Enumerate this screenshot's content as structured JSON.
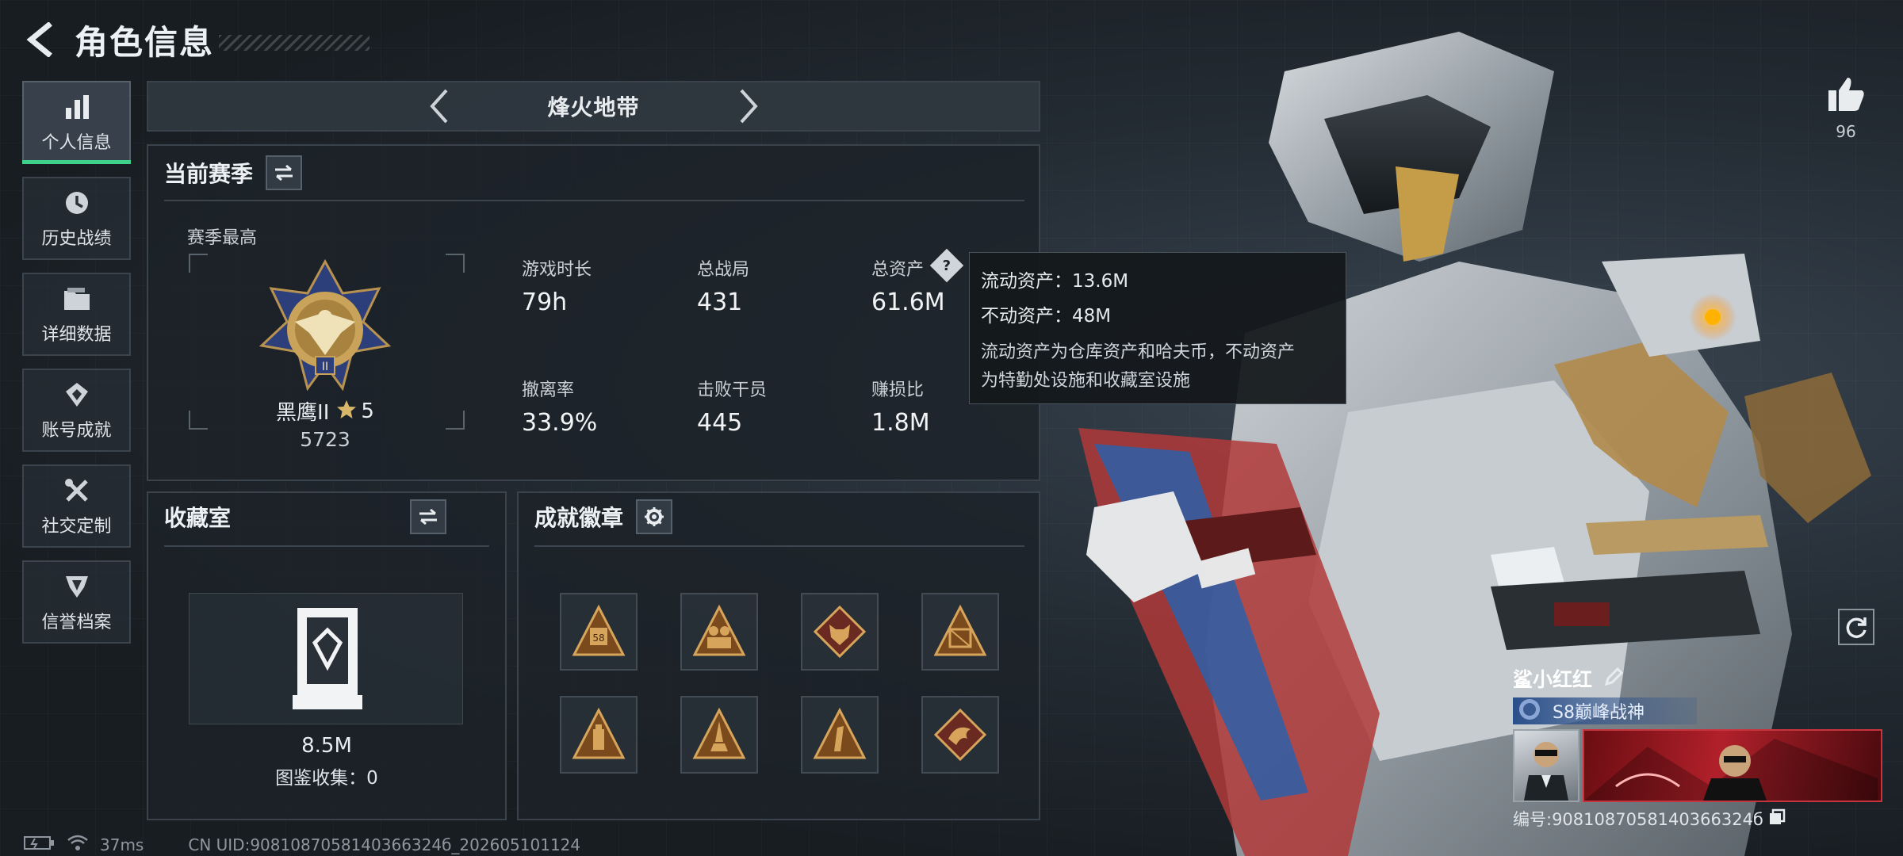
{
  "header": {
    "title": "角色信息"
  },
  "sidebar": {
    "items": [
      {
        "label": "个人信息",
        "icon": "bar-chart-icon",
        "active": true
      },
      {
        "label": "历史战绩",
        "icon": "clock-history-icon"
      },
      {
        "label": "详细数据",
        "icon": "folder-icon"
      },
      {
        "label": "账号成就",
        "icon": "achievement-icon"
      },
      {
        "label": "社交定制",
        "icon": "tools-icon"
      },
      {
        "label": "信誉档案",
        "icon": "credit-emblem-icon"
      }
    ]
  },
  "mode": {
    "title": "烽火地带"
  },
  "season": {
    "title": "当前赛季",
    "best_label": "赛季最高",
    "rank_name": "黑鹰II",
    "rank_stars": "5",
    "rank_score": "5723",
    "stats": [
      {
        "label": "游戏时长",
        "value": "79h"
      },
      {
        "label": "总战局",
        "value": "431"
      },
      {
        "label": "总资产",
        "value": "61.6M"
      },
      {
        "label": "撤离率",
        "value": "33.9%"
      },
      {
        "label": "击败干员",
        "value": "445"
      },
      {
        "label": "赚损比",
        "value": "1.8M"
      }
    ]
  },
  "tooltip": {
    "liquid": "流动资产：13.6M",
    "fixed": "不动资产：48M",
    "desc_line1": "流动资产为仓库资产和哈夫币，不动资产",
    "desc_line2": "为特勤处设施和收藏室设施"
  },
  "collection": {
    "title": "收藏室",
    "value": "8.5M",
    "catalog": "图鉴收集：0"
  },
  "badges": {
    "title": "成就徽章",
    "items": [
      "badge-58-icon",
      "badge-soldiers-icon",
      "badge-wolf-icon",
      "badge-crate-icon",
      "badge-lantern-icon",
      "badge-rocket-icon",
      "badge-number-one-icon",
      "badge-dragon-icon"
    ]
  },
  "like": {
    "count": "96"
  },
  "player": {
    "name": "鲨小红红",
    "rank": "S8巅峰战神",
    "uid": "编号:9081087058140366324б"
  },
  "status": {
    "ping": "37ms",
    "uid_line": "CN UID:9081087058140366324б_202605101124"
  },
  "colors": {
    "accent_green": "#3fd08a",
    "gold": "#c9a35a",
    "rank_blue": "#2a4f8a"
  }
}
